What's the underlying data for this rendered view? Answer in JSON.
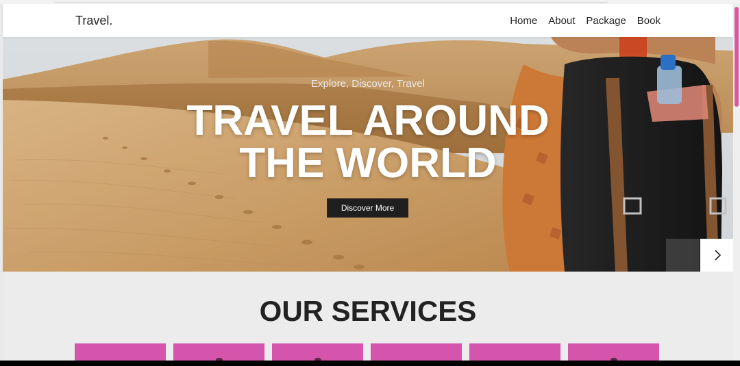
{
  "brand": "Travel.",
  "nav": [
    "Home",
    "About",
    "Package",
    "Book"
  ],
  "hero": {
    "eyebrow": "Explore, Discover, Travel",
    "title_line1": "TRAVEL AROUND",
    "title_line2": "THE WORLD",
    "cta": "Discover More",
    "prev_icon": "chevron-left",
    "next_icon": "chevron-right"
  },
  "services": {
    "title": "OUR SERVICES",
    "card_count": 6
  },
  "colors": {
    "accent": "#d455ab",
    "scroll_thumb": "#e0559d",
    "cta_bg": "#1f1f1f",
    "navbar_bg": "#ffffff"
  }
}
